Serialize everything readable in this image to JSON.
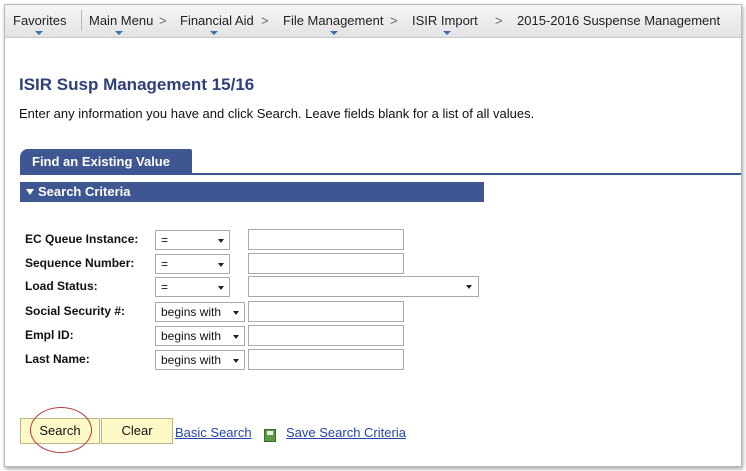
{
  "breadcrumb": {
    "items": [
      "Favorites",
      "Main Menu",
      "Financial Aid",
      "File Management",
      "ISIR Import",
      "2015-2016 Suspense Management"
    ],
    "separator": ">"
  },
  "page": {
    "title": "ISIR Susp Management 15/16",
    "instructions": "Enter any information you have and click Search. Leave fields blank for a list of all values."
  },
  "tab": {
    "label": "Find an Existing Value"
  },
  "section": {
    "label": "Search Criteria"
  },
  "fields": [
    {
      "label": "EC Queue Instance:",
      "operator": "="
    },
    {
      "label": "Sequence Number:",
      "operator": "="
    },
    {
      "label": "Load Status:",
      "operator": "="
    },
    {
      "label": "Social Security #:",
      "operator": "begins with"
    },
    {
      "label": "Empl ID:",
      "operator": "begins with"
    },
    {
      "label": "Last Name:",
      "operator": "begins with"
    }
  ],
  "actions": {
    "search": "Search",
    "clear": "Clear",
    "basic_search": "Basic Search",
    "save_search": "Save Search Criteria"
  },
  "colors": {
    "accent": "#3e5691",
    "title": "#2e3f7a",
    "button_bg": "#fff9c8",
    "link": "#2544a9",
    "highlight_circle": "#b43a3a"
  }
}
